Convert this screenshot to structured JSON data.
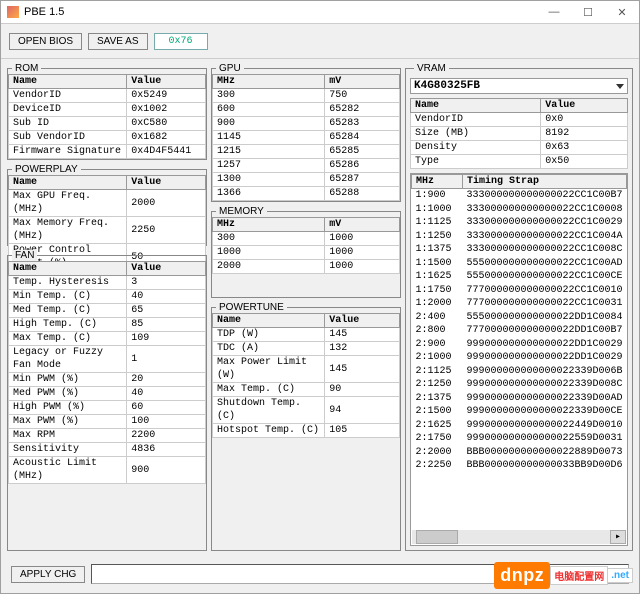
{
  "window": {
    "title": "PBE 1.5",
    "min": "—",
    "max": "☐",
    "close": "✕"
  },
  "toolbar": {
    "open": "OPEN BIOS",
    "save": "SAVE AS",
    "hex": "0x76"
  },
  "rom": {
    "legend": "ROM",
    "headers": [
      "Name",
      "Value"
    ],
    "rows": [
      [
        "VendorID",
        "0x5249"
      ],
      [
        "DeviceID",
        "0x1002"
      ],
      [
        "Sub ID",
        "0xC580"
      ],
      [
        "Sub VendorID",
        "0x1682"
      ],
      [
        "Firmware Signature",
        "0x4D4F5441"
      ]
    ]
  },
  "powerplay": {
    "legend": "POWERPLAY",
    "headers": [
      "Name",
      "Value"
    ],
    "rows": [
      [
        "Max GPU Freq. (MHz)",
        "2000"
      ],
      [
        "Max Memory Freq. (MHz)",
        "2250"
      ],
      [
        "Power Control Limit (%)",
        "50"
      ]
    ]
  },
  "fan": {
    "legend": "FAN",
    "headers": [
      "Name",
      "Value"
    ],
    "rows": [
      [
        "Temp. Hysteresis",
        "3"
      ],
      [
        "Min Temp. (C)",
        "40"
      ],
      [
        "Med Temp. (C)",
        "65"
      ],
      [
        "High Temp. (C)",
        "85"
      ],
      [
        "Max Temp. (C)",
        "109"
      ],
      [
        "Legacy or Fuzzy Fan Mode",
        "1"
      ],
      [
        "Min PWM (%)",
        "20"
      ],
      [
        "Med PWM (%)",
        "40"
      ],
      [
        "High PWM (%)",
        "60"
      ],
      [
        "Max PWM (%)",
        "100"
      ],
      [
        "Max RPM",
        "2200"
      ],
      [
        "Sensitivity",
        "4836"
      ],
      [
        "Acoustic Limit (MHz)",
        "900"
      ]
    ]
  },
  "gpu": {
    "legend": "GPU",
    "headers": [
      "MHz",
      "mV"
    ],
    "rows": [
      [
        "300",
        "750"
      ],
      [
        "600",
        "65282"
      ],
      [
        "900",
        "65283"
      ],
      [
        "1145",
        "65284"
      ],
      [
        "1215",
        "65285"
      ],
      [
        "1257",
        "65286"
      ],
      [
        "1300",
        "65287"
      ],
      [
        "1366",
        "65288"
      ]
    ]
  },
  "memory": {
    "legend": "MEMORY",
    "headers": [
      "MHz",
      "mV"
    ],
    "rows": [
      [
        "300",
        "1000"
      ],
      [
        "1000",
        "1000"
      ],
      [
        "2000",
        "1000"
      ]
    ]
  },
  "powertune": {
    "legend": "POWERTUNE",
    "headers": [
      "Name",
      "Value"
    ],
    "rows": [
      [
        "TDP (W)",
        "145"
      ],
      [
        "TDC (A)",
        "132"
      ],
      [
        "Max Power Limit (W)",
        "145"
      ],
      [
        "Max Temp. (C)",
        "90"
      ],
      [
        "Shutdown Temp. (C)",
        "94"
      ],
      [
        "Hotspot Temp. (C)",
        "105"
      ]
    ]
  },
  "vram": {
    "legend": "VRAM",
    "dropdown": "K4G80325FB",
    "headers": [
      "Name",
      "Value"
    ],
    "rows": [
      [
        "VendorID",
        "0x0"
      ],
      [
        "Size (MB)",
        "8192"
      ],
      [
        "Density",
        "0x63"
      ],
      [
        "Type",
        "0x50"
      ]
    ]
  },
  "straps": {
    "headers": [
      "MHz",
      "Timing Strap"
    ],
    "rows": [
      [
        "1:900",
        "333000000000000022CC1C00B7"
      ],
      [
        "1:1000",
        "333000000000000022CC1C0008"
      ],
      [
        "1:1125",
        "333000000000000022CC1C0029"
      ],
      [
        "1:1250",
        "333000000000000022CC1C004A"
      ],
      [
        "1:1375",
        "333000000000000022CC1C008C"
      ],
      [
        "1:1500",
        "555000000000000022CC1C00AD"
      ],
      [
        "1:1625",
        "555000000000000022CC1C00CE"
      ],
      [
        "1:1750",
        "777000000000000022CC1C0010"
      ],
      [
        "1:2000",
        "777000000000000022CC1C0031"
      ],
      [
        "2:400",
        "555000000000000022DD1C0084"
      ],
      [
        "2:800",
        "777000000000000022DD1C00B7"
      ],
      [
        "2:900",
        "999000000000000022DD1C0029"
      ],
      [
        "2:1000",
        "999000000000000022DD1C0029"
      ],
      [
        "2:1125",
        "999000000000000022339D006B"
      ],
      [
        "2:1250",
        "999000000000000022339D008C"
      ],
      [
        "2:1375",
        "999000000000000022339D00AD"
      ],
      [
        "2:1500",
        "999000000000000022339D00CE"
      ],
      [
        "2:1625",
        "999000000000000022449D0010"
      ],
      [
        "2:1750",
        "999000000000000022559D0031"
      ],
      [
        "2:2000",
        "BBB000000000000022889D0073"
      ],
      [
        "2:2250",
        "BBB000000000000033BB9D00D6"
      ]
    ]
  },
  "footer": {
    "apply": "APPLY CHG"
  },
  "watermark": {
    "logo": "dnpz",
    "txt": "电脑配置网",
    "net": ".net"
  }
}
